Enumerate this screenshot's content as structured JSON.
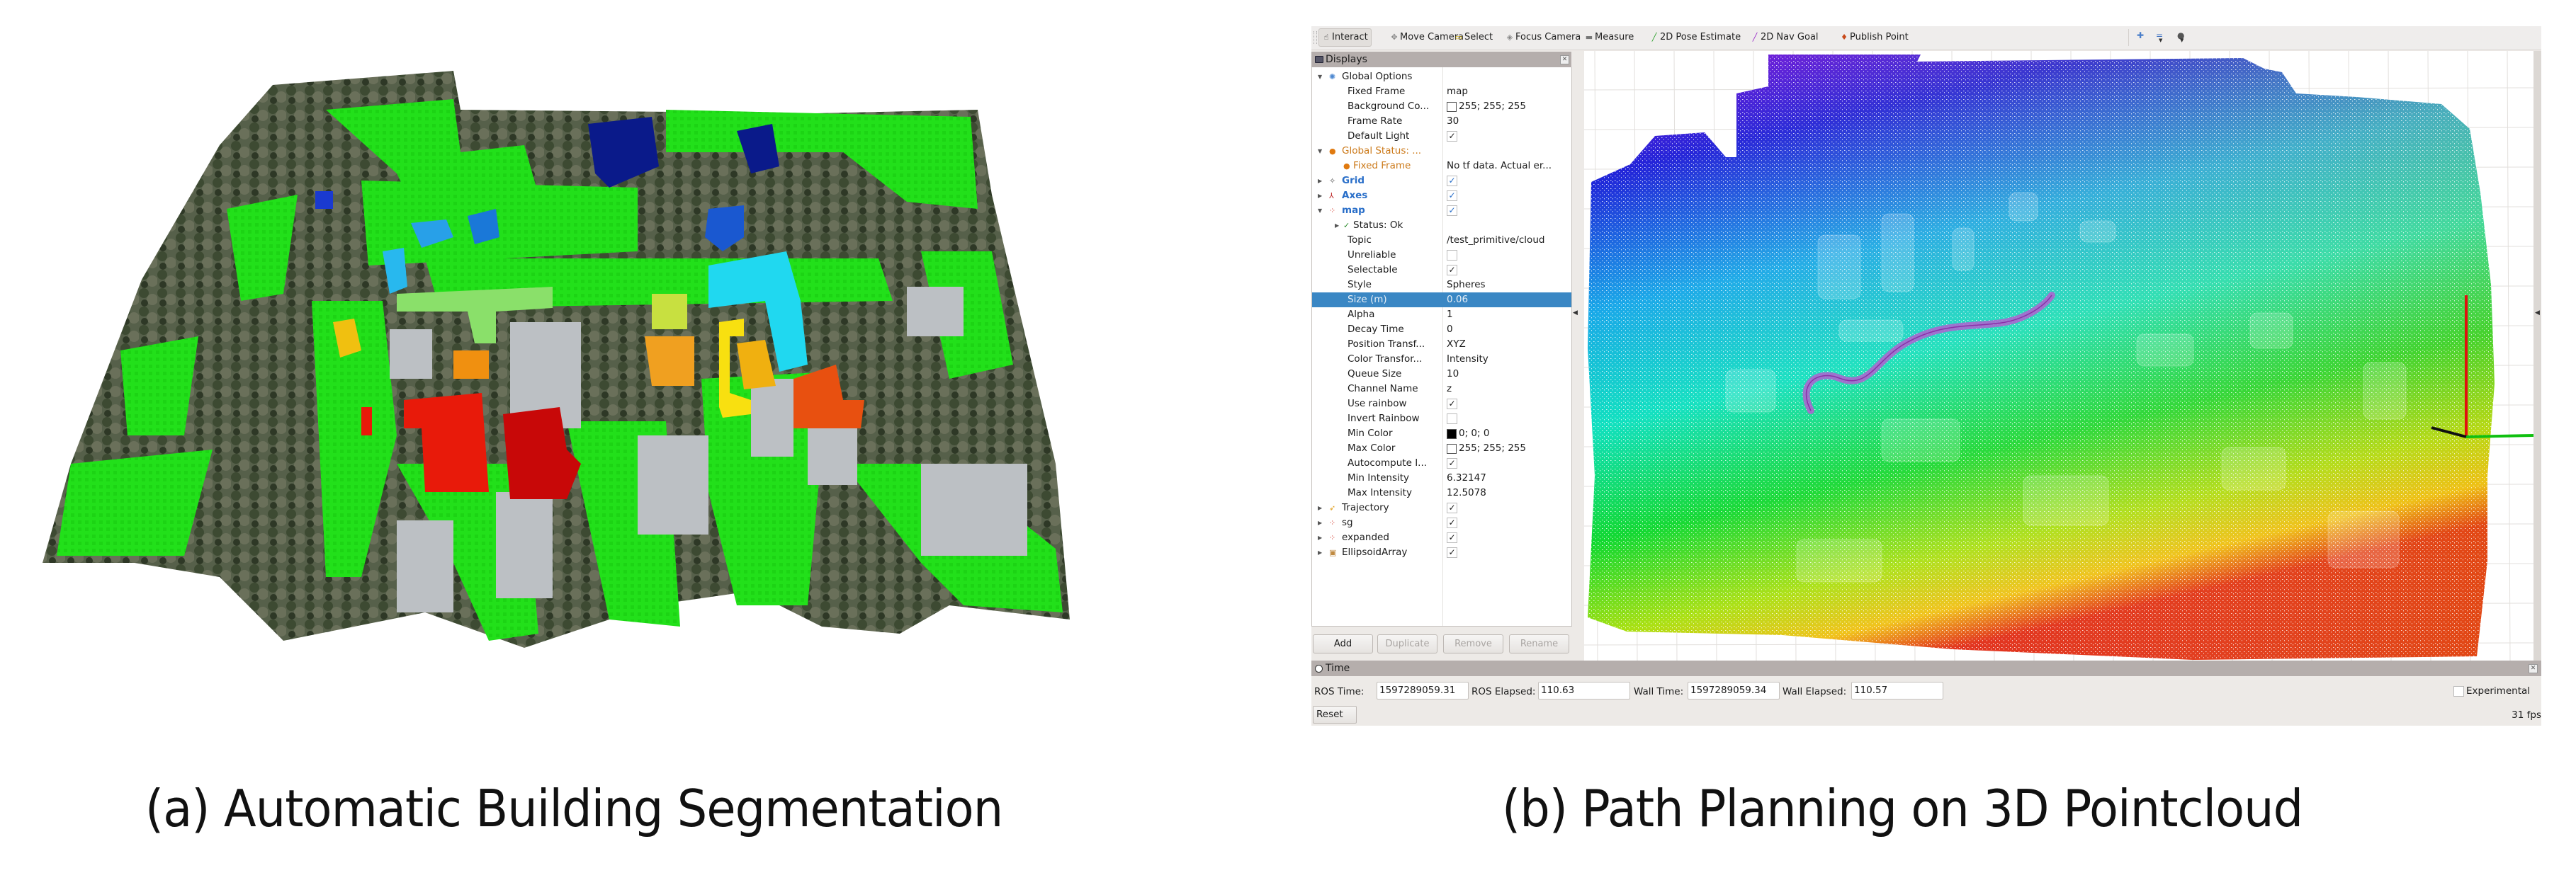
{
  "figure": {
    "captions": {
      "a": "(a) Automatic Building Segmentation",
      "b": "(b) Path Planning on 3D Pointcloud"
    },
    "segmentation_colors": {
      "ground": "#22e01a",
      "trees": "#4a5a3a",
      "roofs_gray": "#b8bcc0",
      "building_classes": [
        "#0a1a8a",
        "#1a4fd0",
        "#2aa8e8",
        "#20d8f0",
        "#f0c010",
        "#f09010",
        "#e85010",
        "#e81a0a",
        "#c80808",
        "#90e070"
      ]
    }
  },
  "rviz": {
    "toolbar": {
      "tools": [
        {
          "label": "Interact",
          "icon": "hand-icon",
          "glyph": "☝",
          "active": true
        },
        {
          "label": "Move Camera",
          "icon": "move-camera-icon",
          "glyph": "✥",
          "active": false
        },
        {
          "label": "Select",
          "icon": "select-icon",
          "glyph": "▭",
          "active": false
        },
        {
          "label": "Focus Camera",
          "icon": "focus-camera-icon",
          "glyph": "◈",
          "active": false
        },
        {
          "label": "Measure",
          "icon": "measure-icon",
          "glyph": "▬",
          "active": false
        },
        {
          "label": "2D Pose Estimate",
          "icon": "pose-estimate-icon",
          "glyph": "╱",
          "active": false
        },
        {
          "label": "2D Nav Goal",
          "icon": "nav-goal-icon",
          "glyph": "╱",
          "active": false
        },
        {
          "label": "Publish Point",
          "icon": "publish-point-icon",
          "glyph": "♦",
          "active": false
        }
      ]
    },
    "displays": {
      "title": "Displays",
      "rows": [
        {
          "label": "Global Options",
          "value": "",
          "indent": 1,
          "arrow": "down",
          "icon": "globe-icon",
          "style": "normal"
        },
        {
          "label": "Fixed Frame",
          "value": "map",
          "indent": 2
        },
        {
          "label": "Background Co...",
          "value": "255; 255; 255",
          "indent": 2,
          "swatch": "#ffffff"
        },
        {
          "label": "Frame Rate",
          "value": "30",
          "indent": 2
        },
        {
          "label": "Default Light",
          "check": true,
          "indent": 2
        },
        {
          "label": "Global Status: ...",
          "value": "",
          "indent": 1,
          "arrow": "down",
          "icon": "warning-icon",
          "style": "orange"
        },
        {
          "label": "Fixed Frame",
          "value": "No tf data.  Actual er...",
          "indent": 2,
          "icon": "warning-icon",
          "style": "orange"
        },
        {
          "label": "Grid",
          "check": true,
          "checkBlue": true,
          "indent": 1,
          "arrow": "right",
          "icon": "grid-icon",
          "style": "blue"
        },
        {
          "label": "Axes",
          "check": true,
          "checkBlue": true,
          "indent": 1,
          "arrow": "right",
          "icon": "axes-icon",
          "style": "blue"
        },
        {
          "label": "map",
          "check": true,
          "checkBlue": true,
          "indent": 1,
          "arrow": "down",
          "icon": "pointcloud-icon",
          "style": "blue"
        },
        {
          "label": "Status: Ok",
          "value": "",
          "indent": 2,
          "arrow": "right",
          "icon": "ok-check-icon"
        },
        {
          "label": "Topic",
          "value": "/test_primitive/cloud",
          "indent": 2
        },
        {
          "label": "Unreliable",
          "check": false,
          "indent": 2
        },
        {
          "label": "Selectable",
          "check": true,
          "indent": 2
        },
        {
          "label": "Style",
          "value": "Spheres",
          "indent": 2
        },
        {
          "label": "Size (m)",
          "value": "0.06",
          "indent": 2,
          "selected": true
        },
        {
          "label": "Alpha",
          "value": "1",
          "indent": 2
        },
        {
          "label": "Decay Time",
          "value": "0",
          "indent": 2
        },
        {
          "label": "Position Transf...",
          "value": "XYZ",
          "indent": 2
        },
        {
          "label": "Color Transfor...",
          "value": "Intensity",
          "indent": 2
        },
        {
          "label": "Queue Size",
          "value": "10",
          "indent": 2
        },
        {
          "label": "Channel Name",
          "value": "z",
          "indent": 2
        },
        {
          "label": "Use rainbow",
          "check": true,
          "indent": 2
        },
        {
          "label": "Invert Rainbow",
          "check": false,
          "indent": 2
        },
        {
          "label": "Min Color",
          "value": "0; 0; 0",
          "indent": 2,
          "swatch": "#000000"
        },
        {
          "label": "Max Color",
          "value": "255; 255; 255",
          "indent": 2,
          "swatch": "#ffffff"
        },
        {
          "label": "Autocompute I...",
          "check": true,
          "indent": 2
        },
        {
          "label": "Min Intensity",
          "value": "6.32147",
          "indent": 2
        },
        {
          "label": "Max Intensity",
          "value": "12.5078",
          "indent": 2
        },
        {
          "label": "Trajectory",
          "check": true,
          "indent": 1,
          "arrow": "right",
          "icon": "trajectory-icon"
        },
        {
          "label": "sg",
          "check": true,
          "indent": 1,
          "arrow": "right",
          "icon": "pointcloud-icon"
        },
        {
          "label": "expanded",
          "check": true,
          "indent": 1,
          "arrow": "right",
          "icon": "pointcloud-icon"
        },
        {
          "label": "EllipsoidArray",
          "check": true,
          "indent": 1,
          "arrow": "right",
          "icon": "ellipsoid-array-icon"
        }
      ],
      "buttons": {
        "add": "Add",
        "duplicate": "Duplicate",
        "remove": "Remove",
        "rename": "Rename"
      }
    },
    "viewport": {
      "background": "#ffffff",
      "path_color": "#b060d0",
      "colormap": "rainbow (z)"
    },
    "time": {
      "title": "Time",
      "ros_time_label": "ROS Time:",
      "ros_time": "1597289059.31",
      "ros_elapsed_label": "ROS Elapsed:",
      "ros_elapsed": "110.63",
      "wall_time_label": "Wall Time:",
      "wall_time": "1597289059.34",
      "wall_elapsed_label": "Wall Elapsed:",
      "wall_elapsed": "110.57",
      "experimental_label": "Experimental",
      "experimental_checked": false,
      "reset_label": "Reset",
      "fps": "31 fps"
    }
  }
}
